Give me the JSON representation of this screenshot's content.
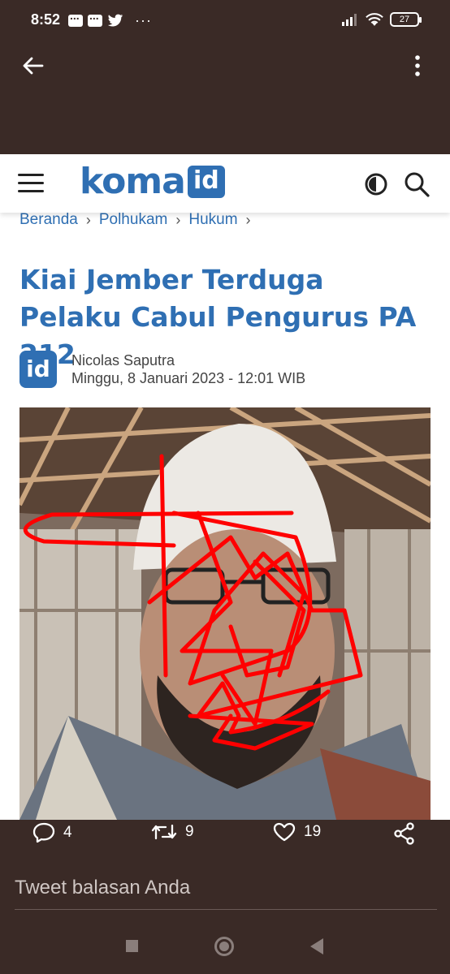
{
  "status_bar": {
    "time": "8:52",
    "battery": "27",
    "overflow_dots": "···"
  },
  "app_bar": {
    "back_icon": "arrow-left-icon",
    "more_icon": "more-vertical-icon"
  },
  "article": {
    "site_logo_text": "koma",
    "site_logo_badge": "id",
    "breadcrumb": [
      "Beranda",
      "Polhukam",
      "Hukum"
    ],
    "breadcrumb_sep": "›",
    "headline": "Kiai Jember Terduga Pelaku Cabul Pengurus PA 212",
    "author_badge": "id",
    "author": "Nicolas Saputra",
    "date": "Minggu, 8 Januari 2023 - 12:01 WIB"
  },
  "tweet_actions": {
    "reply_count": "4",
    "retweet_count": "9",
    "like_count": "19"
  },
  "reply_placeholder": "Tweet balasan Anda",
  "colors": {
    "background": "#3a2a26",
    "brand_blue": "#2f6fb3",
    "scribble_red": "#ff0000"
  }
}
